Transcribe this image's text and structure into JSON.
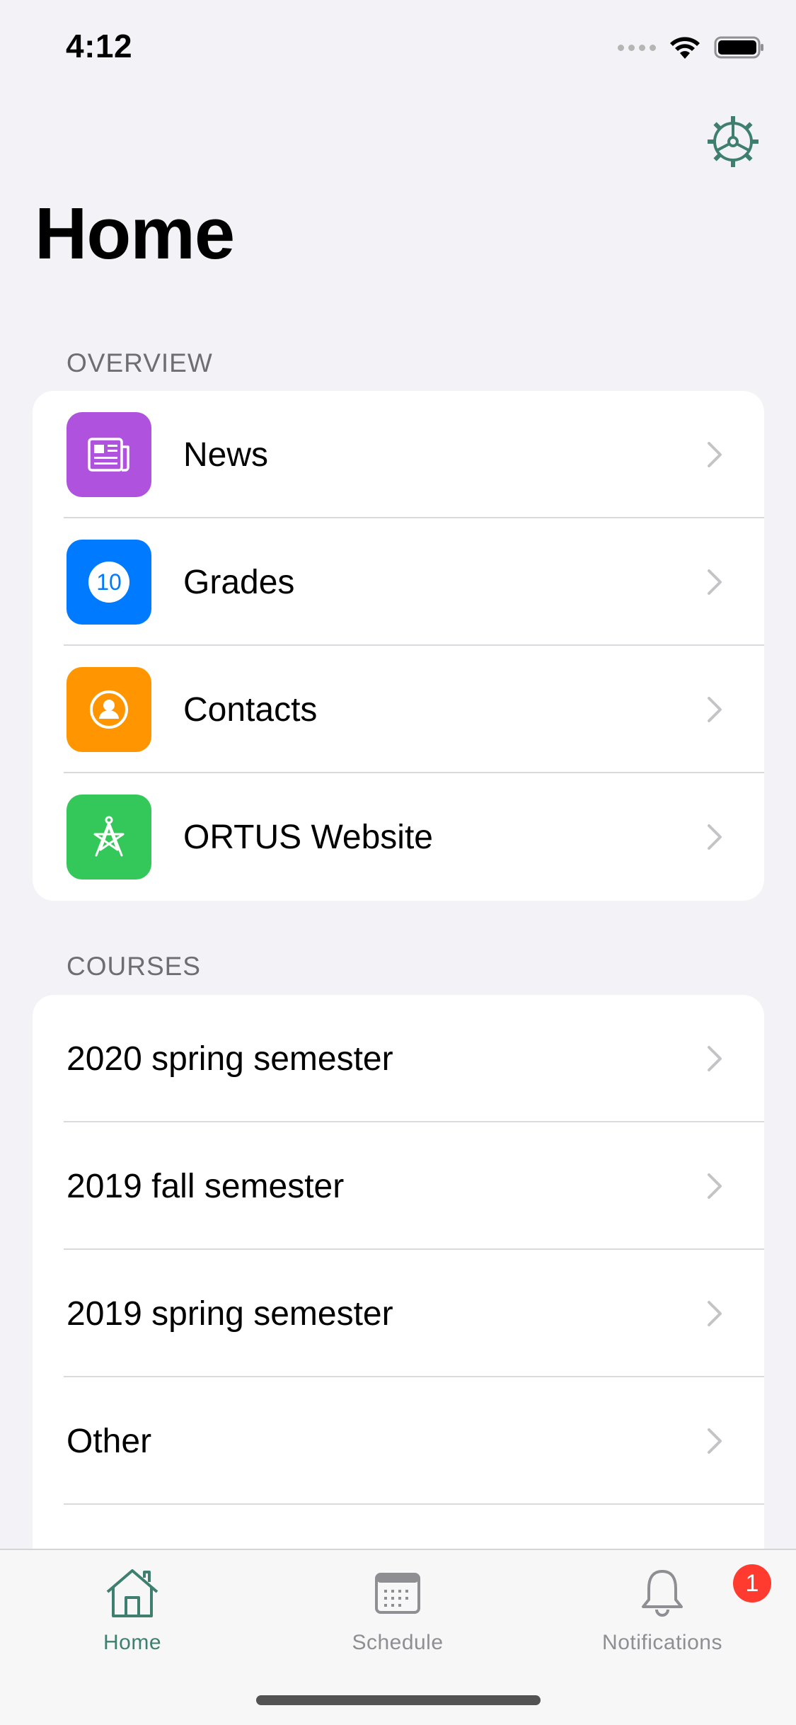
{
  "status_bar": {
    "time": "4:12"
  },
  "header": {
    "title": "Home"
  },
  "overview": {
    "header": "OVERVIEW",
    "items": [
      {
        "label": "News",
        "icon": "newspaper-icon",
        "color": "#af52de"
      },
      {
        "label": "Grades",
        "icon": "grade-10-icon",
        "icon_text": "10",
        "color": "#007aff"
      },
      {
        "label": "Contacts",
        "icon": "person-circle-icon",
        "color": "#ff9500"
      },
      {
        "label": "ORTUS Website",
        "icon": "compass-star-icon",
        "color": "#34c759"
      }
    ]
  },
  "courses": {
    "header": "COURSES",
    "items": [
      {
        "label": "2020 spring semester"
      },
      {
        "label": "2019 fall semester"
      },
      {
        "label": "2019 spring semester"
      },
      {
        "label": "Other"
      }
    ]
  },
  "tab_bar": {
    "tabs": [
      {
        "label": "Home",
        "icon": "house-icon",
        "selected": true
      },
      {
        "label": "Schedule",
        "icon": "calendar-icon",
        "selected": false
      },
      {
        "label": "Notifications",
        "icon": "bell-icon",
        "selected": false,
        "badge": "1"
      }
    ]
  },
  "colors": {
    "accent": "#3e7f70",
    "badge": "#ff3b30",
    "background": "#f2f2f7"
  }
}
